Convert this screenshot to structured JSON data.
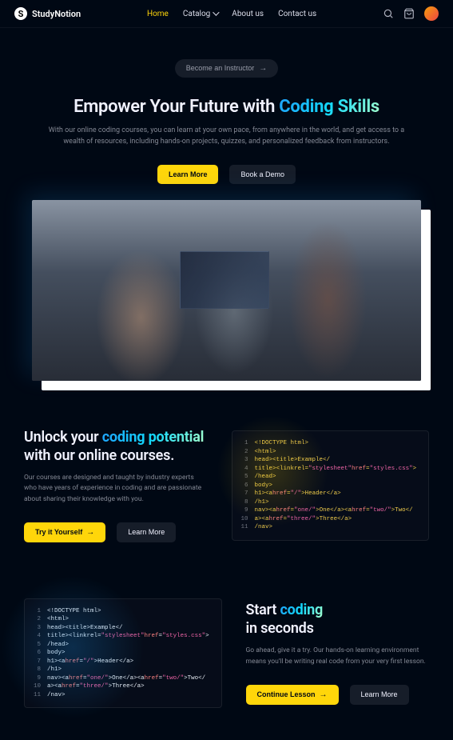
{
  "nav": {
    "brand": "StudyNotion",
    "links": [
      "Home",
      "Catalog",
      "About us",
      "Contact us"
    ],
    "active_index": 0
  },
  "hero": {
    "instructor_btn": "Become an Instructor",
    "title_a": "Empower Your Future with ",
    "title_b": "Coding Skills",
    "subtitle": "With our online coding courses, you can learn at your own pace, from anywhere in the world, and get access to a wealth of resources, including hands-on projects, quizzes, and personalized feedback from instructors.",
    "cta_primary": "Learn More",
    "cta_secondary": "Book a Demo"
  },
  "sec1": {
    "title_a": "Unlock your ",
    "title_b": "coding potential",
    "title_c": " with our online courses.",
    "body": "Our courses are designed and taught by industry experts who have years of experience in coding and are passionate about sharing their knowledge with you.",
    "cta_primary": "Try it Yourself",
    "cta_secondary": "Learn More"
  },
  "sec2": {
    "title_a": "Start ",
    "title_b": "coding",
    "title_c": "in seconds",
    "body": "Go ahead, give it a try. Our hands-on learning environment means you'll be writing real code from your very first lesson.",
    "cta_primary": "Continue Lesson",
    "cta_secondary": "Learn More"
  },
  "code": {
    "lines": [
      "<!DOCTYPE html>",
      "<html>",
      "head><title>Example</",
      "title><linkrel=\"stylesheet\"href=\"styles.css\">",
      "/head>",
      "body>",
      "h1><ahref=\"/\">Header</a>",
      "/h1>",
      "nav><ahref=\"one/\">One</a><ahref=\"two/\">Two</",
      "a><ahref=\"three/\">Three</a>",
      "/nav>"
    ]
  }
}
